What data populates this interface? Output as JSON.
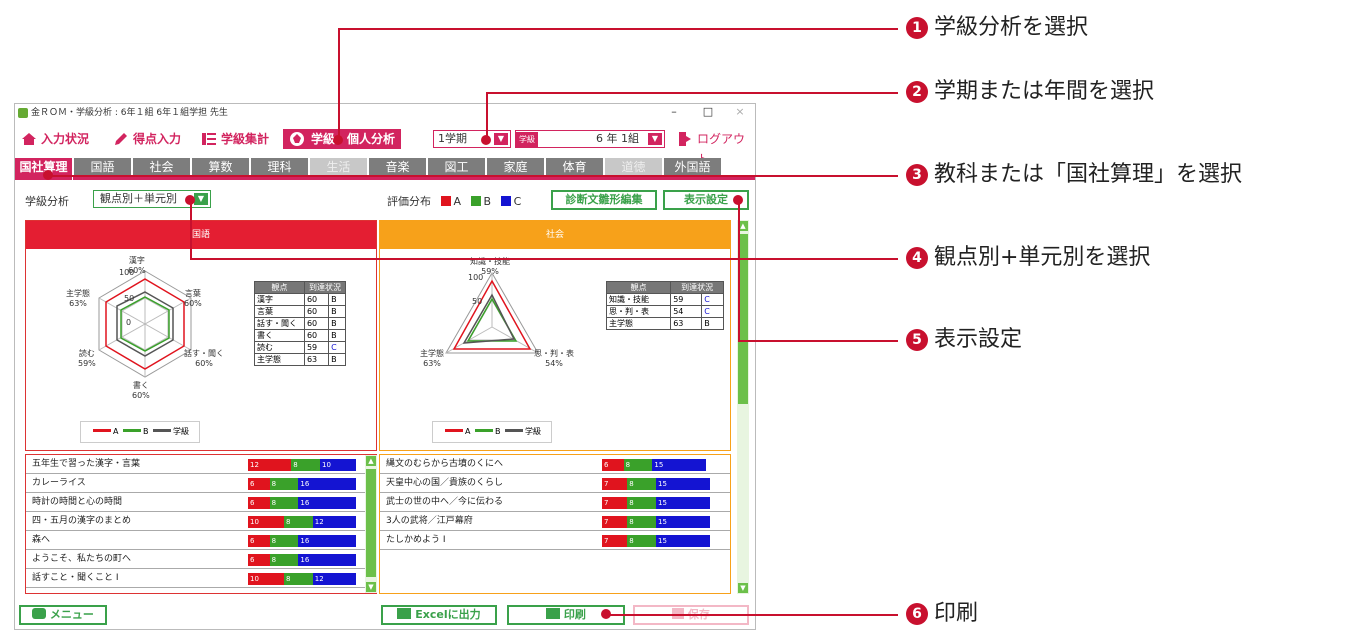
{
  "window": {
    "title": "金ＲＯＭ・学級分析 : 6年１組 6年１組学担 先生",
    "min": "–",
    "max": "□",
    "close": "×"
  },
  "toolbar": {
    "input_status": "入力状況",
    "score_input": "得点入力",
    "class_total": "学級集計",
    "analysis": "学級・個人分析",
    "term": "1学期",
    "class_label": "学級",
    "class_value": "6 年 1組",
    "logout": "ログアウト"
  },
  "tabs": [
    {
      "label": "国社算理"
    },
    {
      "label": "国語"
    },
    {
      "label": "社会"
    },
    {
      "label": "算数"
    },
    {
      "label": "理科"
    },
    {
      "label": "生活"
    },
    {
      "label": "音楽"
    },
    {
      "label": "図工"
    },
    {
      "label": "家庭"
    },
    {
      "label": "体育"
    },
    {
      "label": "道徳"
    },
    {
      "label": "外国語"
    }
  ],
  "subbar": {
    "label": "学級分析",
    "mode": "観点別＋単元別",
    "dist_label": "評価分布",
    "a": "A",
    "b": "B",
    "c": "C",
    "edit_button": "診断文雛形編集",
    "display_button": "表示設定"
  },
  "colors": {
    "accent": "#d2245f",
    "green": "#3aa14a",
    "A": "#e0141e",
    "B": "#3aa12a",
    "C": "#1414d2",
    "japanese": "#e41e32",
    "social": "#f7a11a"
  },
  "japanese": {
    "title": "国語",
    "radar_labels": [
      "漢字",
      "60%",
      "言葉",
      "60%",
      "話す・聞く",
      "60%",
      "書く",
      "60%",
      "読む",
      "59%",
      "主学態",
      "63%"
    ],
    "ticks": [
      "100",
      "50",
      "0"
    ],
    "table_head": [
      "観点",
      "到達状況"
    ],
    "table": [
      [
        "漢字",
        "60",
        "B"
      ],
      [
        "言葉",
        "60",
        "B"
      ],
      [
        "話す・聞く",
        "60",
        "B"
      ],
      [
        "書く",
        "60",
        "B"
      ],
      [
        "読む",
        "59",
        "C"
      ],
      [
        "主学態",
        "63",
        "B"
      ]
    ],
    "legend": [
      "A",
      "B",
      "学級"
    ]
  },
  "social": {
    "title": "社会",
    "radar_labels": [
      "知識・技能",
      "59%",
      "思・判・表",
      "54%",
      "主学態",
      "63%"
    ],
    "ticks": [
      "100",
      "50"
    ],
    "table_head": [
      "観点",
      "到達状況"
    ],
    "table": [
      [
        "知識・技能",
        "59",
        "C"
      ],
      [
        "思・判・表",
        "54",
        "C"
      ],
      [
        "主学態",
        "63",
        "B"
      ]
    ],
    "legend": [
      "A",
      "B",
      "学級"
    ]
  },
  "japanese_units": [
    {
      "name": "五年生で習った漢字・言葉",
      "a": "12",
      "b": "8",
      "c": "10",
      "av": 12,
      "bv": 8,
      "cv": 10
    },
    {
      "name": "カレーライス",
      "a": "6",
      "b": "8",
      "c": "16",
      "av": 6,
      "bv": 8,
      "cv": 16
    },
    {
      "name": "時計の時間と心の時間",
      "a": "6",
      "b": "8",
      "c": "16",
      "av": 6,
      "bv": 8,
      "cv": 16
    },
    {
      "name": "四・五月の漢字のまとめ",
      "a": "10",
      "b": "8",
      "c": "12",
      "av": 10,
      "bv": 8,
      "cv": 12
    },
    {
      "name": "森へ",
      "a": "6",
      "b": "8",
      "c": "16",
      "av": 6,
      "bv": 8,
      "cv": 16
    },
    {
      "name": "ようこそ、私たちの町へ",
      "a": "6",
      "b": "8",
      "c": "16",
      "av": 6,
      "bv": 8,
      "cv": 16
    },
    {
      "name": "話すこと・聞くこと I",
      "a": "10",
      "b": "8",
      "c": "12",
      "av": 10,
      "bv": 8,
      "cv": 12
    }
  ],
  "social_units": [
    {
      "name": "縄文のむらから古墳のくにへ",
      "a": "6",
      "b": "8",
      "c": "15",
      "av": 6,
      "bv": 8,
      "cv": 15
    },
    {
      "name": "天皇中心の国／貴族のくらし",
      "a": "7",
      "b": "8",
      "c": "15",
      "av": 7,
      "bv": 8,
      "cv": 15
    },
    {
      "name": "武士の世の中へ／今に伝わる",
      "a": "7",
      "b": "8",
      "c": "15",
      "av": 7,
      "bv": 8,
      "cv": 15
    },
    {
      "name": "3人の武将／江戸幕府",
      "a": "7",
      "b": "8",
      "c": "15",
      "av": 7,
      "bv": 8,
      "cv": 15
    },
    {
      "name": "たしかめよう I",
      "a": "7",
      "b": "8",
      "c": "15",
      "av": 7,
      "bv": 8,
      "cv": 15
    }
  ],
  "bottom": {
    "menu": "メニュー",
    "excel": "Excelに出力",
    "print": "印刷",
    "save": "保存"
  },
  "annotations": [
    {
      "num": "1",
      "text": "学級分析を選択"
    },
    {
      "num": "2",
      "text": "学期または年間を選択"
    },
    {
      "num": "3",
      "text": "教科または「国社算理」を選択"
    },
    {
      "num": "4",
      "text": "観点別+単元別を選択"
    },
    {
      "num": "5",
      "text": "表示設定"
    },
    {
      "num": "6",
      "text": "印刷"
    }
  ]
}
